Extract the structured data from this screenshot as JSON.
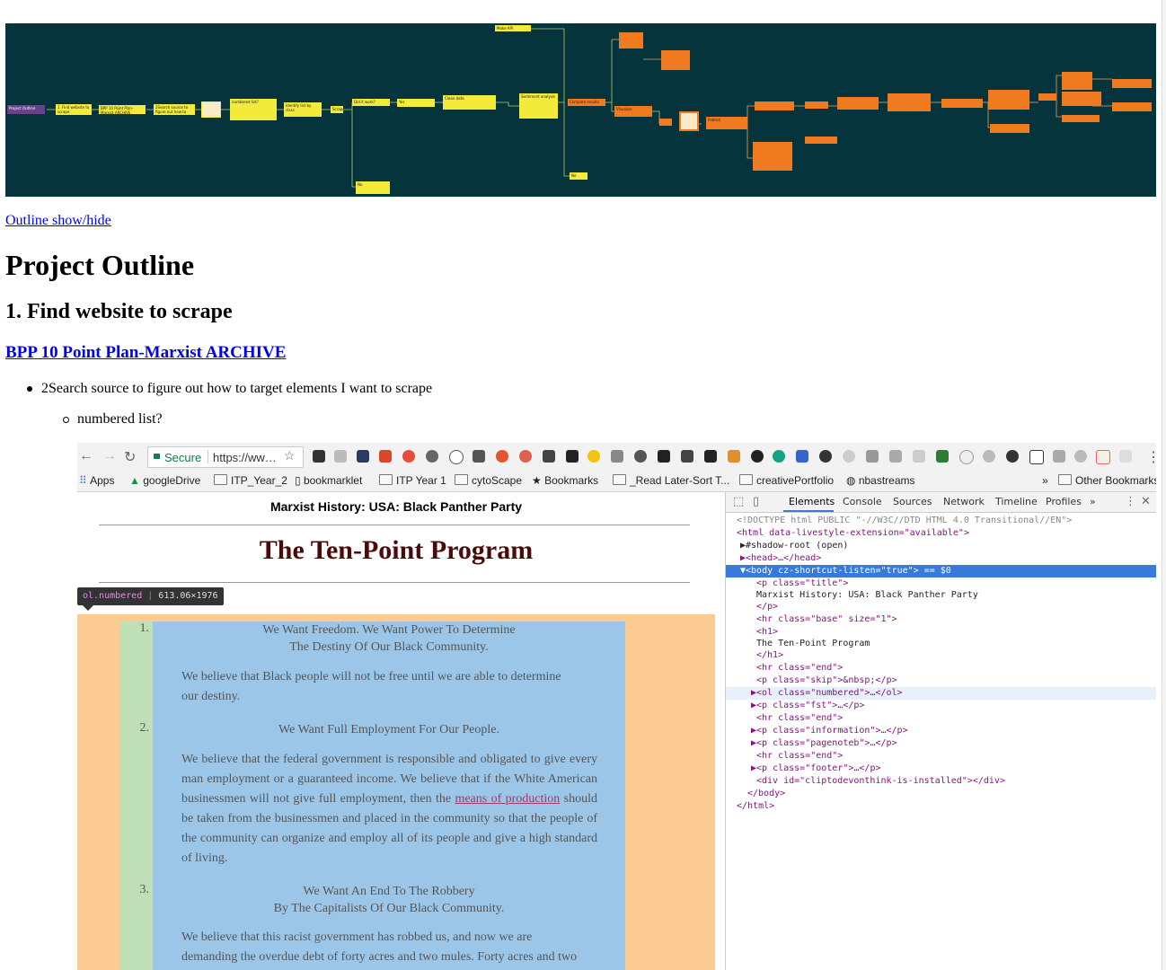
{
  "outline_toggle": "Outline show/hide",
  "mindmap": {
    "root": "Project Outline",
    "n1": "1. Find website to scrape",
    "n2": "BPP 10 Point Plan-Marxist ARCHIVE",
    "n3": "2Search source to figure out how to target elements I want to scrape",
    "n4": "numbered list?",
    "n5": "Identify list by class",
    "n6": "Scrape",
    "n7": "Did it work?",
    "n8": "No",
    "n9": "Yes",
    "n10": "Clean data",
    "n11": "Make API",
    "n12": "Sentiment analysis",
    "n13": "Compare results",
    "n14": "Visualize",
    "n15": "Publish"
  },
  "h1": "Project Outline",
  "h2": "1. Find website to scrape",
  "h3_link": "BPP 10 Point Plan-Marxist ARCHIVE",
  "bullet1": "2Search source to figure out how to target elements I want to scrape",
  "bullet2": "numbered list?",
  "browser": {
    "secure": "Secure",
    "url": "https://ww…",
    "bookmarks": [
      {
        "label": "Apps"
      },
      {
        "label": "googleDrive"
      },
      {
        "label": "ITP_Year_2"
      },
      {
        "label": "bookmarklet"
      },
      {
        "label": "ITP Year 1"
      },
      {
        "label": "cytoScape"
      },
      {
        "label": "Bookmarks"
      },
      {
        "label": "_Read Later-Sort T..."
      },
      {
        "label": "creativePortfolio"
      },
      {
        "label": "nbastreams"
      },
      {
        "label": "»"
      },
      {
        "label": "Other Bookmarks"
      }
    ]
  },
  "page": {
    "site_title": "Marxist History: USA: Black Panther Party",
    "heading": "The Ten-Point Program",
    "tooltip_selector": "ol.numbered",
    "tooltip_dims": "613.06×1976",
    "items": [
      {
        "num": "1.",
        "head1": "We Want Freedom. We Want Power To Determine",
        "head2": "The Destiny Of Our Black Community.",
        "body": [
          "We believe that Black people will not be free until we are able to determine",
          "our destiny."
        ]
      },
      {
        "num": "2.",
        "head1": "We Want Full Employment For Our People.",
        "body_a": "We believe that the federal government is responsible and obligated to give every man employment or a guaranteed income. We believe that if the White American businessmen will not give full employment, then the",
        "body_link": "means of production",
        "body_b": "should be taken from the businessmen and placed in the community so that the people of the community can organize and employ all of its people and give a high standard of living."
      },
      {
        "num": "3.",
        "head1": "We Want An End To The Robbery",
        "head2": "By The Capitalists Of Our Black Community.",
        "body": [
          "We believe that this racist government has robbed us, and now we are",
          "demanding the overdue debt of forty acres and two mules. Forty acres and two"
        ]
      }
    ]
  },
  "devtools": {
    "tabs": [
      "Elements",
      "Console",
      "Sources",
      "Network",
      "Timeline",
      "Profiles",
      "»"
    ],
    "dom": [
      "<!DOCTYPE html PUBLIC \"-//W3C//DTD HTML 4.0 Transitional//EN\">",
      "<html data-livestyle-extension=\"available\">",
      "▶#shadow-root (open)",
      "▶<head>…</head>",
      "▼<body cz-shortcut-listen=\"true\"> == $0",
      "<p class=\"title\">",
      "Marxist History: USA: Black Panther Party",
      "</p>",
      "<hr class=\"base\" size=\"1\">",
      "<h1>",
      "The Ten-Point Program",
      "</h1>",
      "<hr class=\"end\">",
      "<p class=\"skip\">&nbsp;</p>",
      "▶<ol class=\"numbered\">…</ol>",
      "▶<p class=\"fst\">…</p>",
      "<hr class=\"end\">",
      "▶<p class=\"information\">…</p>",
      "▶<p class=\"pagenoteb\">…</p>",
      "<hr class=\"end\">",
      "▶<p class=\"footer\">…</p>",
      "<div id=\"cliptodevonthink-is-installed\"></div>",
      "</body>",
      "</html>"
    ]
  },
  "colors": {
    "mindmap_bg": "#06343d",
    "node_yellow": "#f4ea3a",
    "node_orange": "#f07a1f",
    "link": "#0000ee",
    "margin_box": "#fbcb93",
    "padding_box": "#bfe0b6",
    "content_box": "#9cc6e8",
    "devtools_selected": "#3879d9"
  }
}
